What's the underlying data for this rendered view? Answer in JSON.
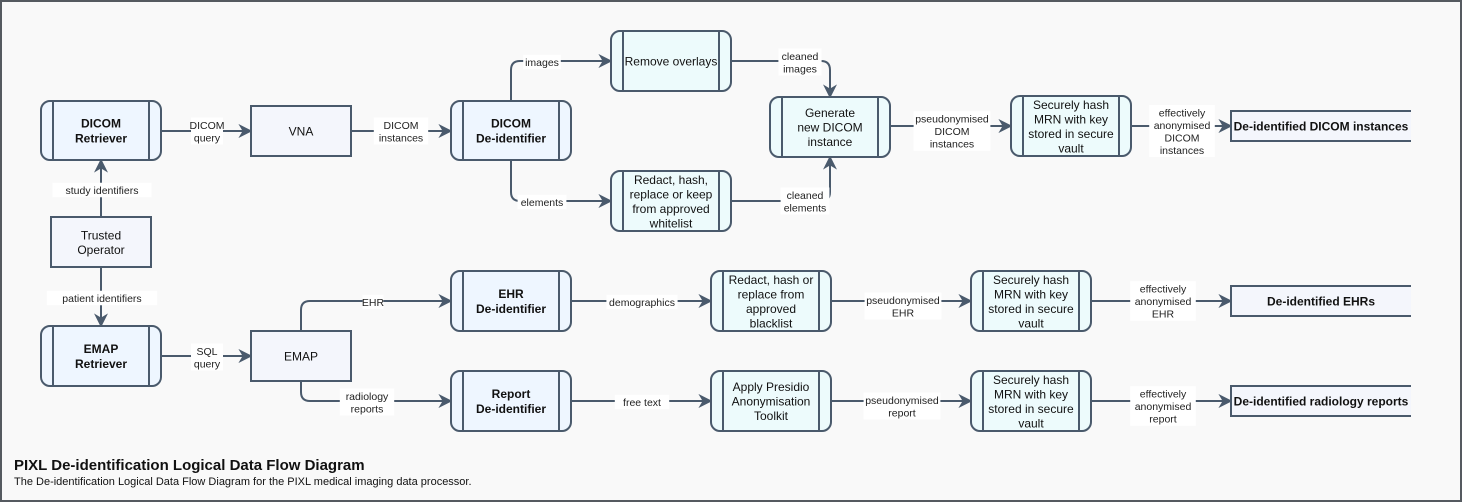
{
  "colors": {
    "stroke": "#4a5a6c",
    "process_fill": "#eef6ff",
    "transform_fill": "#edfbfc",
    "entity_fill": "#f4f6fc",
    "store_fill": "#f4f6fc",
    "background": "#f9f9f9"
  },
  "nodes": [
    {
      "id": "dicom-retriever",
      "type": "process",
      "bold": true,
      "lines": [
        "DICOM",
        "Retriever"
      ]
    },
    {
      "id": "vna",
      "type": "entity",
      "bold": false,
      "lines": [
        "VNA"
      ]
    },
    {
      "id": "dicom-deidentifier",
      "type": "process",
      "bold": true,
      "lines": [
        "DICOM",
        "De-identifier"
      ]
    },
    {
      "id": "remove-overlays",
      "type": "transform",
      "bold": false,
      "lines": [
        "Remove overlays"
      ]
    },
    {
      "id": "redact-whitelist",
      "type": "transform",
      "bold": false,
      "lines": [
        "Redact, hash,",
        "replace or keep",
        "from approved",
        "whitelist"
      ]
    },
    {
      "id": "generate-dicom",
      "type": "transform",
      "bold": false,
      "lines": [
        "Generate",
        "new DICOM",
        "instance"
      ]
    },
    {
      "id": "hash-mrn-dicom",
      "type": "transform",
      "bold": false,
      "lines": [
        "Securely hash",
        "MRN with key",
        "stored in secure",
        "vault"
      ]
    },
    {
      "id": "store-dicom",
      "type": "store",
      "bold": true,
      "lines": [
        "De-identified DICOM instances"
      ]
    },
    {
      "id": "trusted-operator",
      "type": "entity",
      "bold": false,
      "lines": [
        "Trusted",
        "Operator"
      ]
    },
    {
      "id": "emap-retriever",
      "type": "process",
      "bold": true,
      "lines": [
        "EMAP",
        "Retriever"
      ]
    },
    {
      "id": "emap",
      "type": "entity",
      "bold": false,
      "lines": [
        "EMAP"
      ]
    },
    {
      "id": "ehr-deidentifier",
      "type": "process",
      "bold": true,
      "lines": [
        "EHR",
        "De-identifier"
      ]
    },
    {
      "id": "redact-blacklist",
      "type": "transform",
      "bold": false,
      "lines": [
        "Redact, hash or",
        "replace from",
        "approved",
        "blacklist"
      ]
    },
    {
      "id": "hash-mrn-ehr",
      "type": "transform",
      "bold": false,
      "lines": [
        "Securely hash",
        "MRN with key",
        "stored in secure",
        "vault"
      ]
    },
    {
      "id": "store-ehr",
      "type": "store",
      "bold": true,
      "lines": [
        "De-identified EHRs"
      ]
    },
    {
      "id": "report-deidentifier",
      "type": "process",
      "bold": true,
      "lines": [
        "Report",
        "De-identifier"
      ]
    },
    {
      "id": "presidio",
      "type": "transform",
      "bold": false,
      "lines": [
        "Apply Presidio",
        "Anonymisation",
        "Toolkit"
      ]
    },
    {
      "id": "hash-mrn-report",
      "type": "transform",
      "bold": false,
      "lines": [
        "Securely hash",
        "MRN with key",
        "stored in secure",
        "vault"
      ]
    },
    {
      "id": "store-reports",
      "type": "store",
      "bold": true,
      "lines": [
        "De-identified radiology reports"
      ]
    }
  ],
  "edges": [
    {
      "id": "dicom-query",
      "from": "dicom-retriever",
      "to": "vna",
      "label": [
        "DICOM",
        "query"
      ]
    },
    {
      "id": "dicom-instances",
      "from": "vna",
      "to": "dicom-deidentifier",
      "label": [
        "DICOM",
        "instances"
      ]
    },
    {
      "id": "images",
      "from": "dicom-deidentifier",
      "to": "remove-overlays",
      "label": [
        "images"
      ]
    },
    {
      "id": "elements",
      "from": "dicom-deidentifier",
      "to": "redact-whitelist",
      "label": [
        "elements"
      ]
    },
    {
      "id": "cleaned-images",
      "from": "remove-overlays",
      "to": "generate-dicom",
      "label": [
        "cleaned",
        "images"
      ]
    },
    {
      "id": "cleaned-elements",
      "from": "redact-whitelist",
      "to": "generate-dicom",
      "label": [
        "cleaned",
        "elements"
      ]
    },
    {
      "id": "pseudonymised-dicom",
      "from": "generate-dicom",
      "to": "hash-mrn-dicom",
      "label": [
        "pseudonymised",
        "DICOM",
        "instances"
      ]
    },
    {
      "id": "anonymised-dicom",
      "from": "hash-mrn-dicom",
      "to": "store-dicom",
      "label": [
        "effectively",
        "anonymised",
        "DICOM",
        "instances"
      ]
    },
    {
      "id": "study-identifiers",
      "from": "trusted-operator",
      "to": "dicom-retriever",
      "label": [
        "study identifiers"
      ]
    },
    {
      "id": "patient-identifiers",
      "from": "trusted-operator",
      "to": "emap-retriever",
      "label": [
        "patient identifiers"
      ]
    },
    {
      "id": "sql-query",
      "from": "emap-retriever",
      "to": "emap",
      "label": [
        "SQL",
        "query"
      ]
    },
    {
      "id": "ehr",
      "from": "emap",
      "to": "ehr-deidentifier",
      "label": [
        "EHR"
      ]
    },
    {
      "id": "radiology-reports",
      "from": "emap",
      "to": "report-deidentifier",
      "label": [
        "radiology",
        "reports"
      ]
    },
    {
      "id": "demographics",
      "from": "ehr-deidentifier",
      "to": "redact-blacklist",
      "label": [
        "demographics"
      ]
    },
    {
      "id": "pseudonymised-ehr",
      "from": "redact-blacklist",
      "to": "hash-mrn-ehr",
      "label": [
        "pseudonymised",
        "EHR"
      ]
    },
    {
      "id": "anonymised-ehr",
      "from": "hash-mrn-ehr",
      "to": "store-ehr",
      "label": [
        "effectively",
        "anonymised",
        "EHR"
      ]
    },
    {
      "id": "free-text",
      "from": "report-deidentifier",
      "to": "presidio",
      "label": [
        "free text"
      ]
    },
    {
      "id": "pseudonymised-report",
      "from": "presidio",
      "to": "hash-mrn-report",
      "label": [
        "pseudonymised",
        "report"
      ]
    },
    {
      "id": "anonymised-report",
      "from": "hash-mrn-report",
      "to": "store-reports",
      "label": [
        "effectively",
        "anonymised",
        "report"
      ]
    }
  ],
  "caption": {
    "title": "PIXL De-identification Logical Data Flow Diagram",
    "subtitle": "The De-identification Logical Data Flow Diagram for the PIXL medical imaging data processor."
  }
}
